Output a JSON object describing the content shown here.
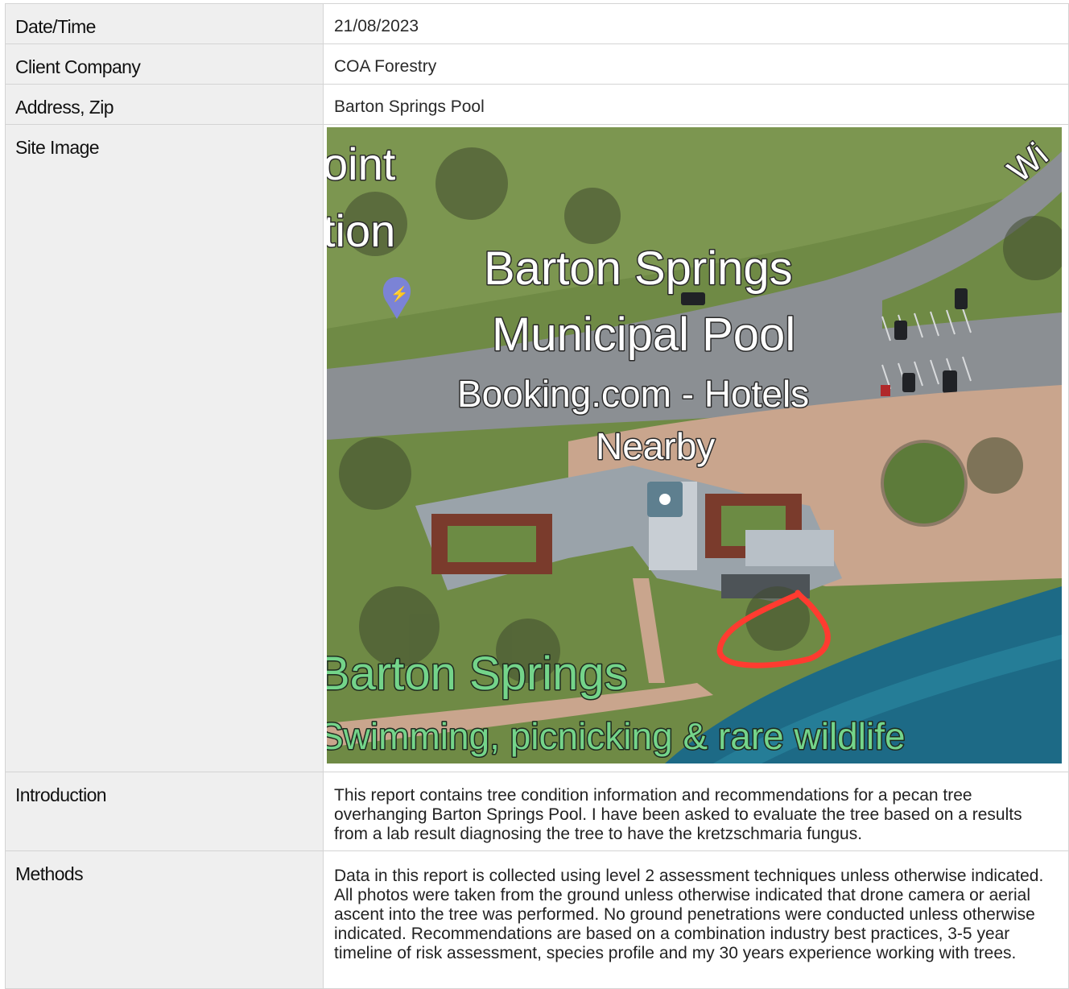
{
  "rows": [
    {
      "label": "Date/Time",
      "value": "21/08/2023"
    },
    {
      "label": "Client Company",
      "value": "COA Forestry"
    },
    {
      "label": "Address, Zip",
      "value": "Barton Springs Pool"
    }
  ],
  "site_image": {
    "label": "Site Image",
    "map_labels": {
      "fragment_top_1": "oint",
      "fragment_top_2": "tion",
      "fragment_top_right": "Wi",
      "pool_name_1": "Barton Springs",
      "pool_name_2": "Municipal Pool",
      "booking_1": "Booking.com - Hotels",
      "booking_2": "Nearby",
      "park_name": "Barton Springs",
      "park_desc": "Swimming, picnicking & rare wildlife"
    },
    "colors": {
      "grass": "#6f8a45",
      "road": "#8b8f93",
      "plaza": "#c9a58d",
      "water": "#1d6a86",
      "marker": "#ff3b30",
      "pin": "#7b83d6"
    }
  },
  "introduction": {
    "label": "Introduction",
    "text": "This report contains tree condition information and recommendations for a pecan tree overhanging Barton Springs Pool. I have been asked to evaluate the tree based on a results from a lab result diagnosing the tree to have the kretzschmaria fungus."
  },
  "methods": {
    "label": "Methods",
    "text": "Data in this report is collected using level 2 assessment techniques unless otherwise indicated.  All photos were taken from the ground unless otherwise indicated that drone camera or aerial ascent into the tree was performed.  No ground penetrations were conducted unless otherwise indicated.  Recommendations are based on a combination industry best practices, 3-5 year timeline of risk assessment, species profile and my 30 years experience working with trees."
  }
}
